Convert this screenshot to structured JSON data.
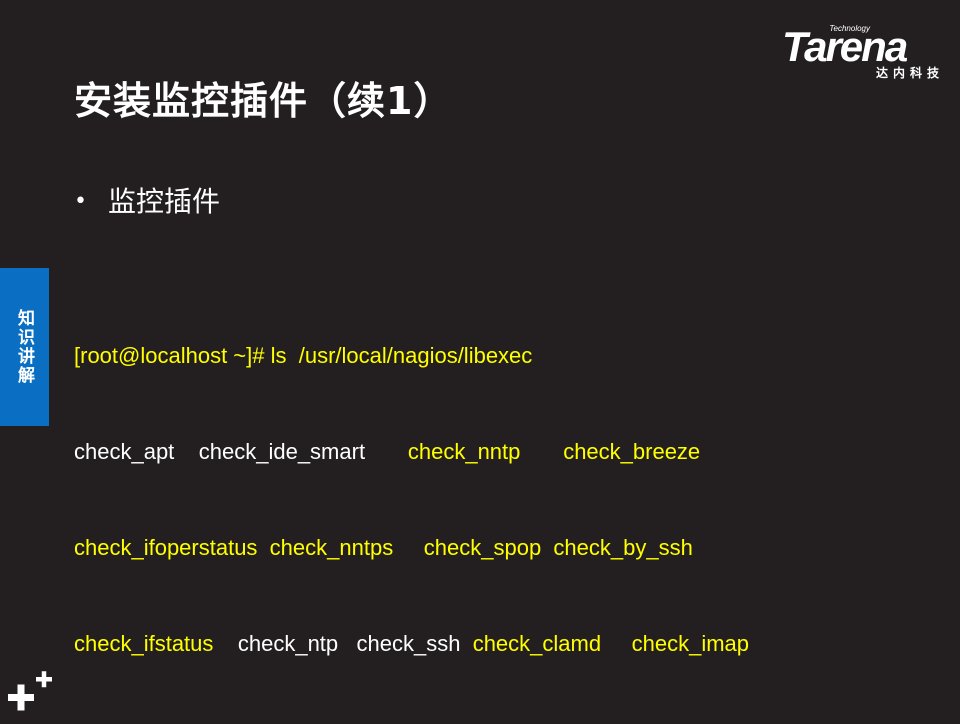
{
  "header": {
    "title": "安装监控插件（续1）"
  },
  "logo": {
    "technology": "Technology",
    "brand": "Tarena",
    "chinese": "达内科技"
  },
  "side_tab": {
    "label": "知识讲解"
  },
  "content": {
    "bullet": "监控插件",
    "command": "[root@localhost ~]# ls  /usr/local/nagios/libexec",
    "rows": [
      [
        "check_apt",
        "check_ide_smart",
        "check_nntp",
        "check_breeze"
      ],
      [
        "check_ifoperstatus",
        "check_nntps",
        "check_spop",
        "check_by_ssh"
      ],
      [
        "check_ifstatus",
        "check_ntp",
        "check_ssh",
        "check_clamd",
        "check_imap"
      ]
    ]
  },
  "colors": {
    "background": "#231f20",
    "highlight": "#ffff00",
    "tab": "#0a6fc2"
  },
  "icons": {
    "corner": "plus-icon"
  }
}
